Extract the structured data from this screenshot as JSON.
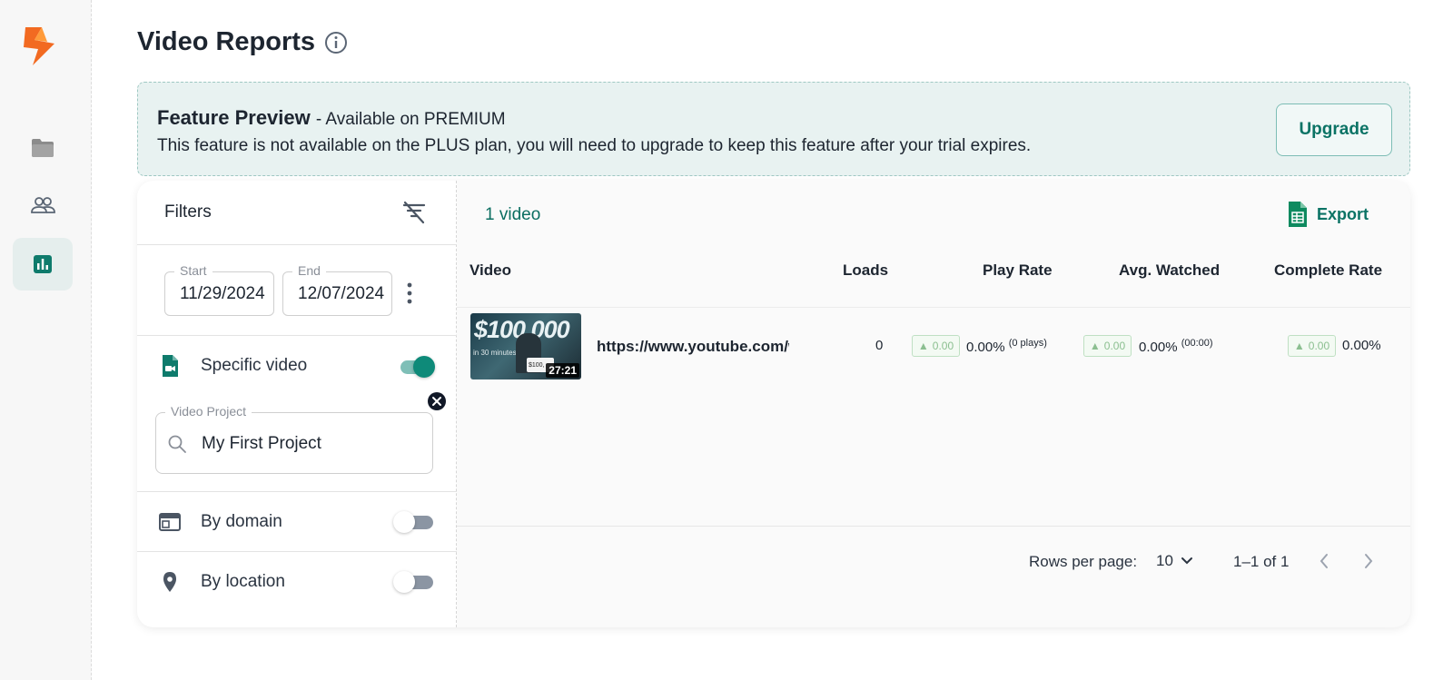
{
  "page": {
    "title": "Video Reports"
  },
  "sidebar": {
    "items": [
      {
        "icon": "folder-icon"
      },
      {
        "icon": "people-icon"
      },
      {
        "icon": "bar-chart-icon"
      }
    ]
  },
  "banner": {
    "title": "Feature Preview",
    "subtitle": "- Available on PREMIUM",
    "description": "This feature is not available on the PLUS plan, you will need to upgrade to keep this feature after your trial expires.",
    "button": "Upgrade"
  },
  "filters": {
    "title": "Filters",
    "start_label": "Start",
    "start_value": "11/29/2024",
    "end_label": "End",
    "end_value": "12/07/2024",
    "specific_video": {
      "label": "Specific video",
      "enabled": true
    },
    "project_label": "Video Project",
    "project_value": "My First Project",
    "by_domain": {
      "label": "By domain",
      "enabled": false
    },
    "by_location": {
      "label": "By location",
      "enabled": false
    }
  },
  "table": {
    "count": "1 video",
    "export": "Export",
    "headers": [
      "Video",
      "Loads",
      "Play Rate",
      "Avg. Watched",
      "Complete Rate"
    ],
    "rows": [
      {
        "thumb_text": "$100,000",
        "thumb_sub": "in 30 minutes",
        "thumb_card": "$100,",
        "duration": "27:21",
        "url": "https://www.youtube.com/watch",
        "loads": "0",
        "play_rate_trend": "0.00",
        "play_rate": "0.00%",
        "play_rate_note": "(0 plays)",
        "avg_watched_trend": "0.00",
        "avg_watched": "0.00%",
        "avg_watched_note": "(00:00)",
        "complete_trend": "0.00",
        "complete_rate": "0.00%"
      }
    ],
    "rows_per_page_label": "Rows per page:",
    "rows_per_page": "10",
    "range": "1–1 of 1"
  },
  "colors": {
    "accent": "#0e8a79",
    "banner_bg": "#e8f2f1",
    "logo_orange": "#f26a21"
  }
}
